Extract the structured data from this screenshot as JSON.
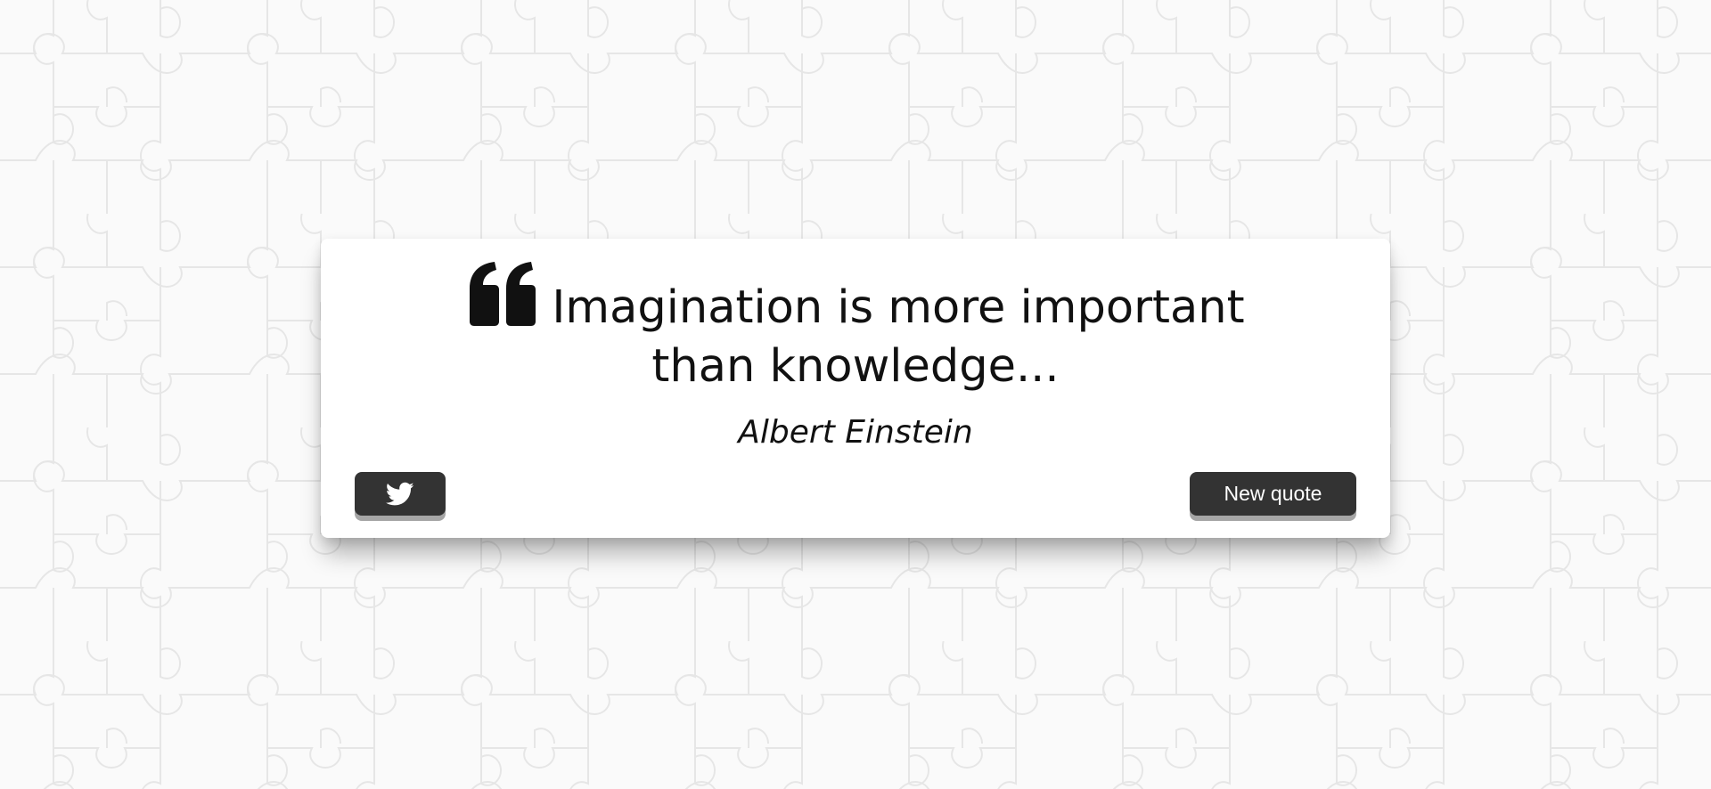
{
  "quote": {
    "text": "Imagination is more important than knowledge...",
    "author": "Albert Einstein"
  },
  "buttons": {
    "tweet_icon": "twitter-icon",
    "new_quote_label": "New quote"
  },
  "colors": {
    "page_background": "#fafafa",
    "pattern_lines": "#e6e6e6",
    "card_background": "#ffffff",
    "text": "#111111",
    "button_background": "#333333",
    "button_shadow": "#a6a6a6",
    "button_text": "#ffffff"
  },
  "icons": {
    "quote": "quote-left-icon",
    "tweet": "twitter-icon"
  }
}
